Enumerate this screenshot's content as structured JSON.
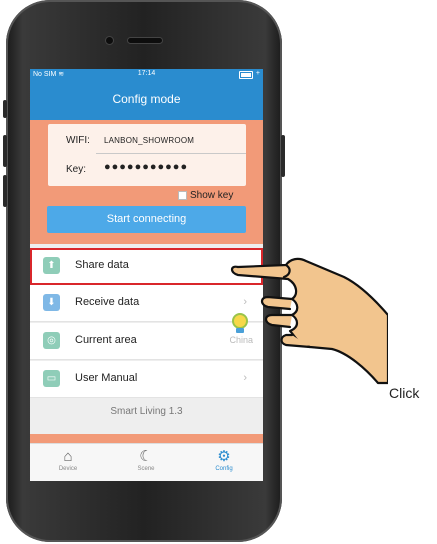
{
  "status_bar": {
    "carrier": "No SIM",
    "time": "17:14"
  },
  "nav": {
    "title": "Config mode"
  },
  "wifi_form": {
    "wifi_label": "WIFI:",
    "wifi_value": "LANBON_SHOWROOM",
    "key_label": "Key:",
    "key_value": "●●●●●●●●●●●"
  },
  "show_key_label": "Show key",
  "connect_button": "Start connecting",
  "menu": {
    "items": [
      {
        "label": "Share data",
        "icon": "upload-icon"
      },
      {
        "label": "Receive data",
        "icon": "download-icon"
      },
      {
        "label": "Current area",
        "icon": "globe-icon",
        "value": "China"
      },
      {
        "label": "User Manual",
        "icon": "book-icon"
      }
    ],
    "version": "Smart Living 1.3"
  },
  "tabs": [
    {
      "label": "Device",
      "icon": "home-icon"
    },
    {
      "label": "Scene",
      "icon": "scene-icon"
    },
    {
      "label": "Config",
      "icon": "gear-icon",
      "active": true
    }
  ],
  "annotation": {
    "click_label": "Click"
  },
  "colors": {
    "brand_blue": "#2a8ccf",
    "button_blue": "#4da9e8",
    "peach": "#f29a78",
    "highlight_red": "#d9262b",
    "icon_green": "#8fcdb8"
  }
}
